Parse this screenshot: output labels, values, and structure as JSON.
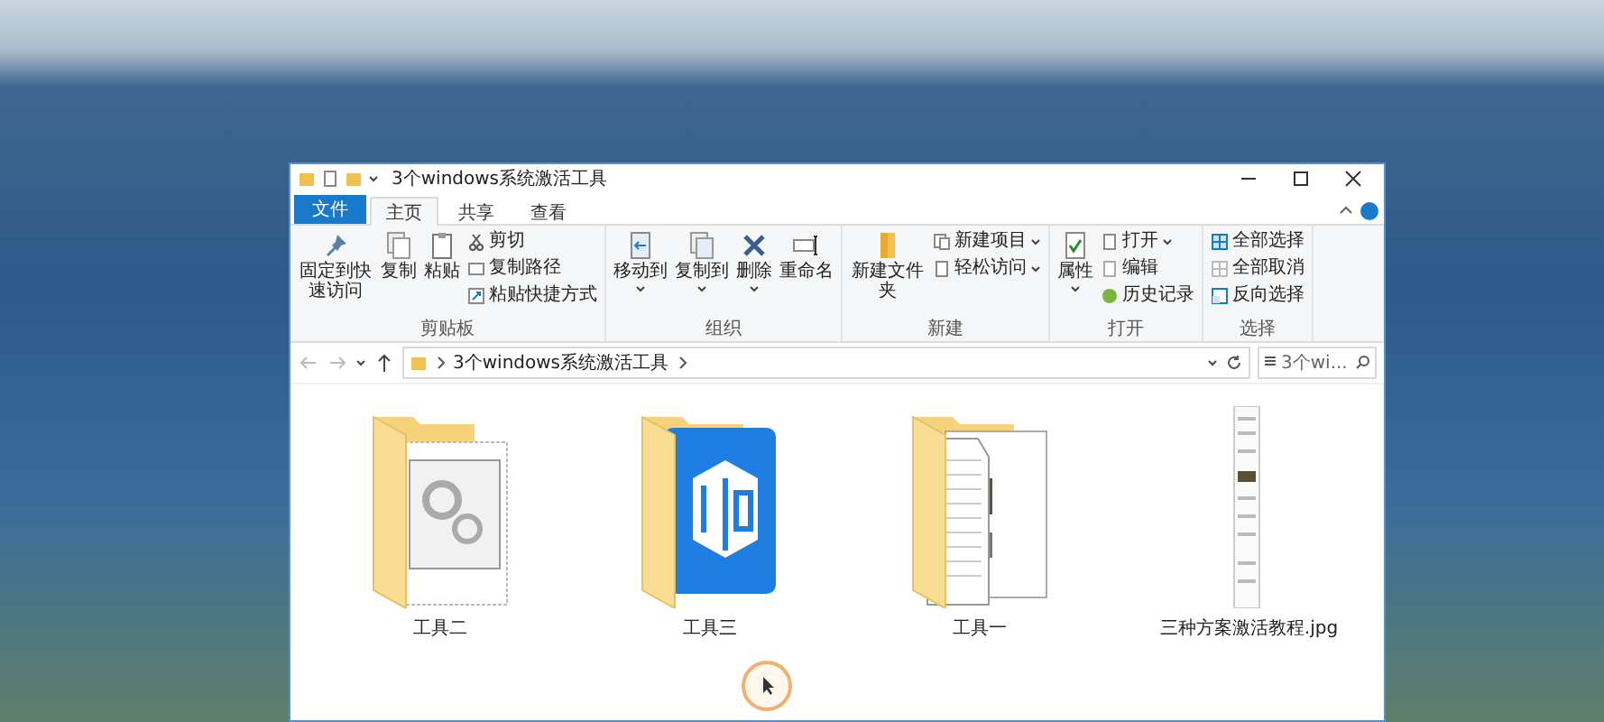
{
  "window": {
    "title": "3个windows系统激活工具"
  },
  "file_tab": {
    "label": "文件"
  },
  "tabs": [
    {
      "label": "主页",
      "selected": true
    },
    {
      "label": "共享",
      "selected": false
    },
    {
      "label": "查看",
      "selected": false
    }
  ],
  "ribbon_groups": [
    {
      "label": "剪贴板",
      "items": [
        {
          "label": "固定到快速访问",
          "kind": "large",
          "menu": false
        },
        {
          "label": "复制",
          "kind": "large",
          "menu": false
        },
        {
          "label": "粘贴",
          "kind": "large",
          "menu": false
        },
        {
          "label": "剪切",
          "kind": "small",
          "menu": false
        },
        {
          "label": "复制路径",
          "kind": "small",
          "menu": false
        },
        {
          "label": "粘贴快捷方式",
          "kind": "small",
          "menu": false
        }
      ]
    },
    {
      "label": "组织",
      "items": [
        {
          "label": "移动到",
          "kind": "large",
          "menu": true
        },
        {
          "label": "复制到",
          "kind": "large",
          "menu": true
        },
        {
          "label": "删除",
          "kind": "large",
          "menu": true
        },
        {
          "label": "重命名",
          "kind": "large",
          "menu": false
        }
      ]
    },
    {
      "label": "新建",
      "items": [
        {
          "label": "新建文件夹",
          "kind": "large",
          "menu": false
        },
        {
          "label": "新建项目",
          "kind": "small",
          "menu": true
        },
        {
          "label": "轻松访问",
          "kind": "small",
          "menu": true
        }
      ]
    },
    {
      "label": "打开",
      "items": [
        {
          "label": "属性",
          "kind": "large",
          "menu": true
        },
        {
          "label": "打开",
          "kind": "small",
          "menu": true
        },
        {
          "label": "编辑",
          "kind": "small",
          "menu": false
        },
        {
          "label": "历史记录",
          "kind": "small",
          "menu": false
        }
      ]
    },
    {
      "label": "选择",
      "items": [
        {
          "label": "全部选择",
          "kind": "small",
          "menu": false
        },
        {
          "label": "全部取消",
          "kind": "small",
          "menu": false
        },
        {
          "label": "反向选择",
          "kind": "small",
          "menu": false
        }
      ]
    }
  ],
  "address": {
    "path": "3个windows系统激活工具"
  },
  "search": {
    "placeholder": "3个wi..."
  },
  "files": [
    {
      "name": "工具二",
      "kind": "folder-gears"
    },
    {
      "name": "工具三",
      "kind": "folder-app"
    },
    {
      "name": "工具一",
      "kind": "folder-docs"
    },
    {
      "name": "三种方案激活教程.jpg",
      "kind": "image"
    }
  ]
}
